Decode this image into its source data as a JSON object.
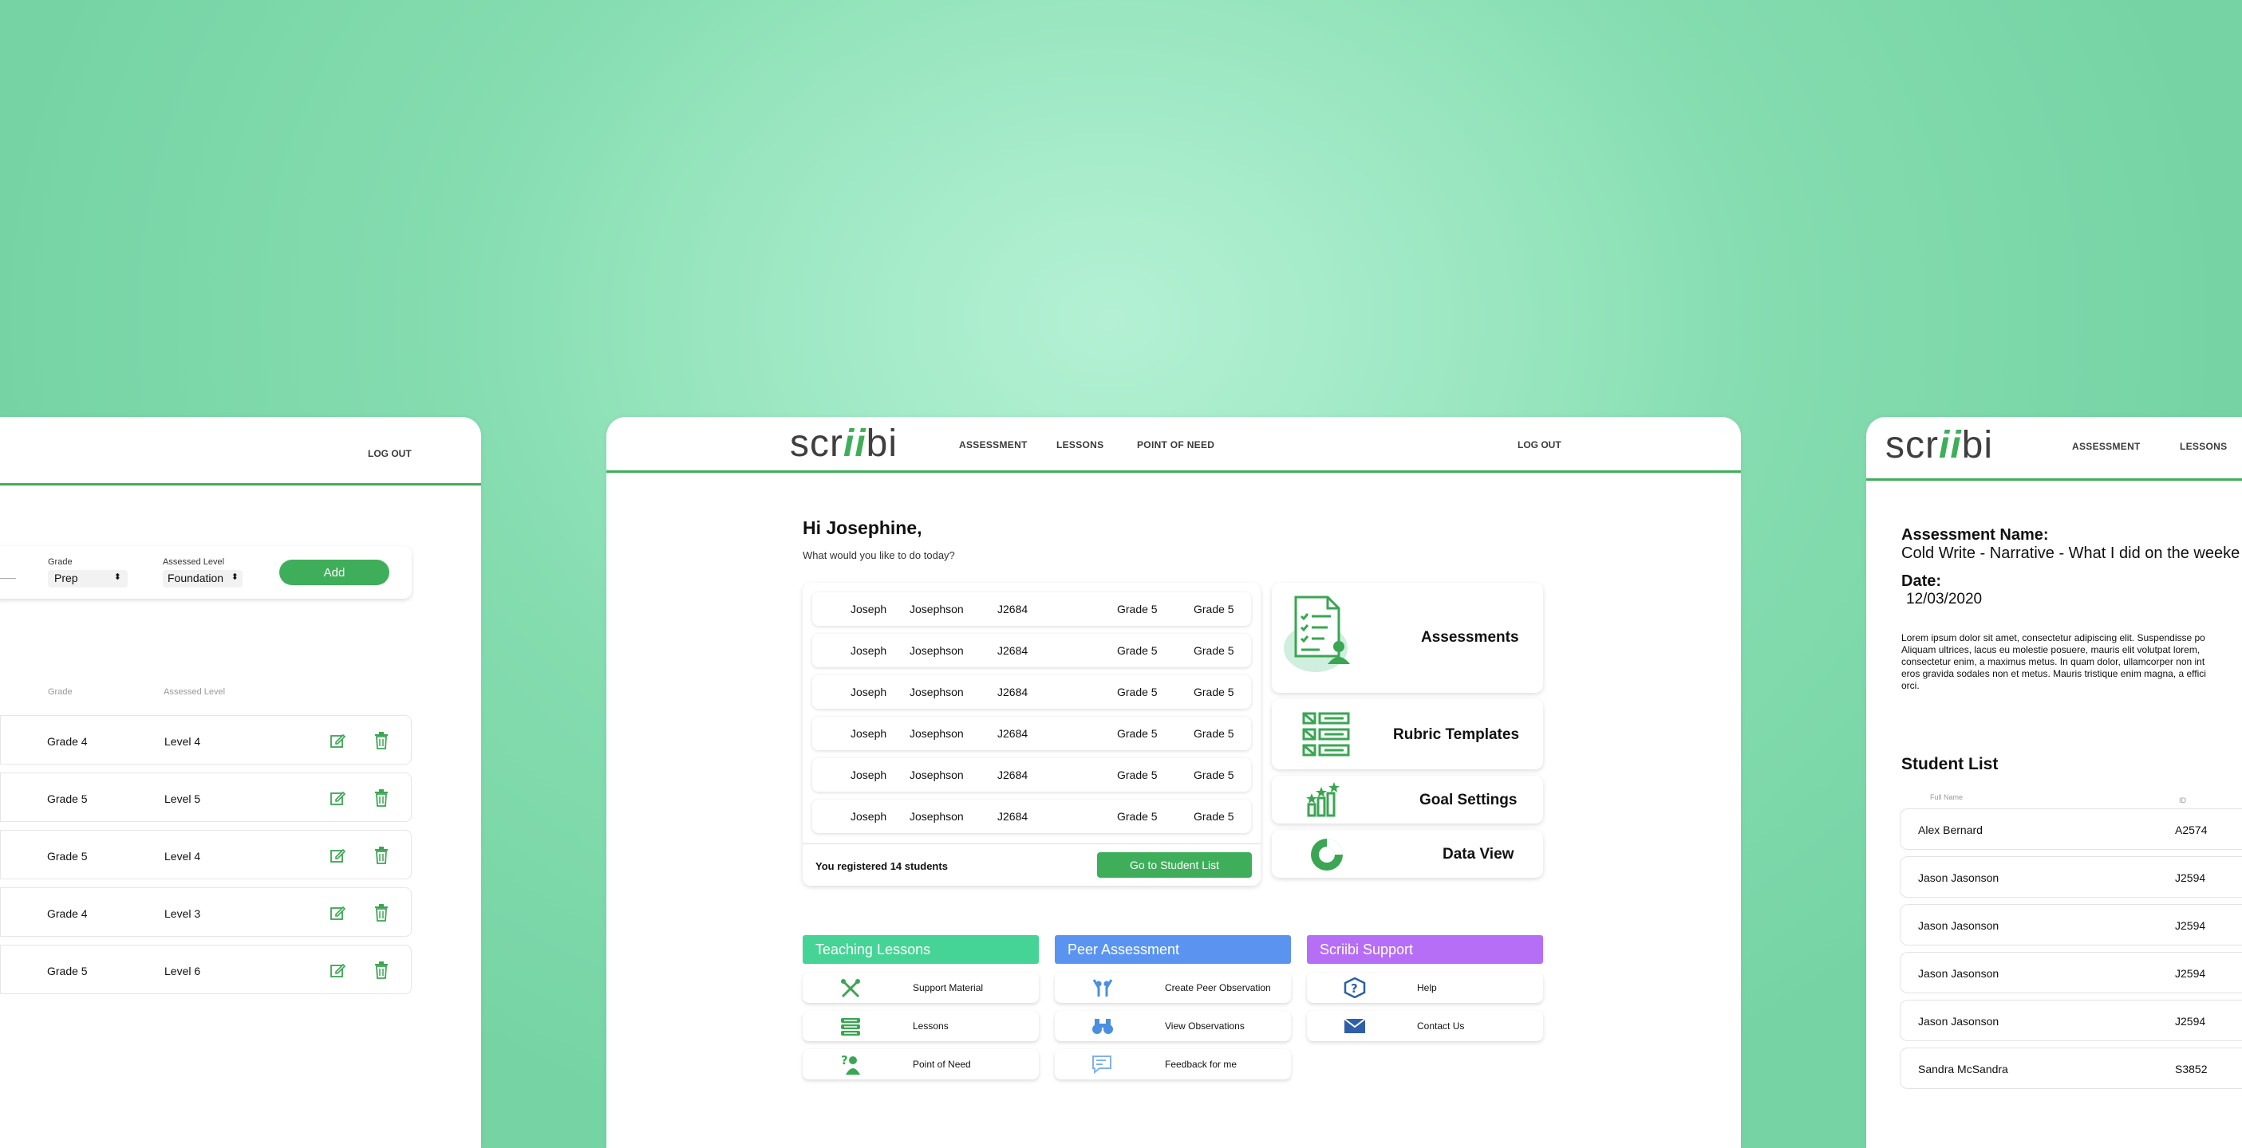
{
  "left_panel": {
    "logout": "LOG OUT",
    "form": {
      "grade_label": "Grade",
      "grade_value": "Prep",
      "level_label": "Assessed Level",
      "level_value": "Foundation",
      "add_label": "Add"
    },
    "table_headers": {
      "grade": "Grade",
      "level": "Assessed Level"
    },
    "rows": [
      {
        "grade": "Grade 4",
        "level": "Level 4"
      },
      {
        "grade": "Grade 5",
        "level": "Level 5"
      },
      {
        "grade": "Grade 5",
        "level": "Level 4"
      },
      {
        "grade": "Grade 4",
        "level": "Level 3"
      },
      {
        "grade": "Grade 5",
        "level": "Level 6"
      }
    ]
  },
  "center_panel": {
    "logo": {
      "pre": "scr",
      "mid": "ii",
      "post": "bi"
    },
    "nav": [
      "ASSESSMENT",
      "LESSONS",
      "POINT OF NEED"
    ],
    "logout": "LOG OUT",
    "greeting": "Hi Josephine,",
    "subtitle": "What would you like to do today?",
    "students": [
      {
        "first": "Joseph",
        "last": "Josephson",
        "id": "J2684",
        "grade": "Grade 5",
        "level": "Grade 5"
      },
      {
        "first": "Joseph",
        "last": "Josephson",
        "id": "J2684",
        "grade": "Grade 5",
        "level": "Grade 5"
      },
      {
        "first": "Joseph",
        "last": "Josephson",
        "id": "J2684",
        "grade": "Grade 5",
        "level": "Grade 5"
      },
      {
        "first": "Joseph",
        "last": "Josephson",
        "id": "J2684",
        "grade": "Grade 5",
        "level": "Grade 5"
      },
      {
        "first": "Joseph",
        "last": "Josephson",
        "id": "J2684",
        "grade": "Grade 5",
        "level": "Grade 5"
      },
      {
        "first": "Joseph",
        "last": "Josephson",
        "id": "J2684",
        "grade": "Grade 5",
        "level": "Grade 5"
      }
    ],
    "registered_prefix": "You registered ",
    "registered_count": "14 students",
    "goto_button": "Go to Student List",
    "tiles": {
      "assessments": "Assessments",
      "rubric": "Rubric Templates",
      "goals": "Goal Settings",
      "data": "Data View"
    },
    "sections": {
      "teaching": {
        "title": "Teaching Lessons",
        "color": "#45d495",
        "items": [
          "Support Material",
          "Lessons",
          "Point of Need"
        ]
      },
      "peer": {
        "title": "Peer Assessment",
        "color": "#5b94f0",
        "items": [
          "Create Peer Observation",
          "View Observations",
          "Feedback for me"
        ]
      },
      "support": {
        "title": "Scriibi Support",
        "color": "#b66ef6",
        "items": [
          "Help",
          "Contact Us"
        ]
      }
    }
  },
  "right_panel": {
    "logo": {
      "pre": "scr",
      "mid": "ii",
      "post": "bi"
    },
    "nav": [
      "ASSESSMENT",
      "LESSONS"
    ],
    "assessment_name_label": "Assessment Name:",
    "assessment_name": "Cold Write - Narrative - What I did on the weeke",
    "date_label": "Date:",
    "date": "12/03/2020",
    "lorem": [
      "Lorem ipsum dolor sit amet, consectetur adipiscing elit. Suspendisse po",
      "Aliquam ultrices, lacus eu molestie posuere, mauris elit volutpat lorem,",
      "consectetur enim, a maximus metus. In quam dolor, ullamcorper non int",
      "eros gravida sodales non et metus. Mauris tristique enim magna, a effici",
      "orci."
    ],
    "student_list_title": "Student List",
    "headers": {
      "name": "Full Name",
      "id": "ID"
    },
    "rows": [
      {
        "name": "Alex Bernard",
        "id": "A2574"
      },
      {
        "name": "Jason Jasonson",
        "id": "J2594"
      },
      {
        "name": "Jason Jasonson",
        "id": "J2594"
      },
      {
        "name": "Jason Jasonson",
        "id": "J2594"
      },
      {
        "name": "Jason Jasonson",
        "id": "J2594"
      },
      {
        "name": "Sandra McSandra",
        "id": "S3852"
      }
    ]
  },
  "colors": {
    "brand_green": "#3fae5a",
    "icon_green": "#3aa653",
    "icon_blue": "#2f5fa8"
  }
}
